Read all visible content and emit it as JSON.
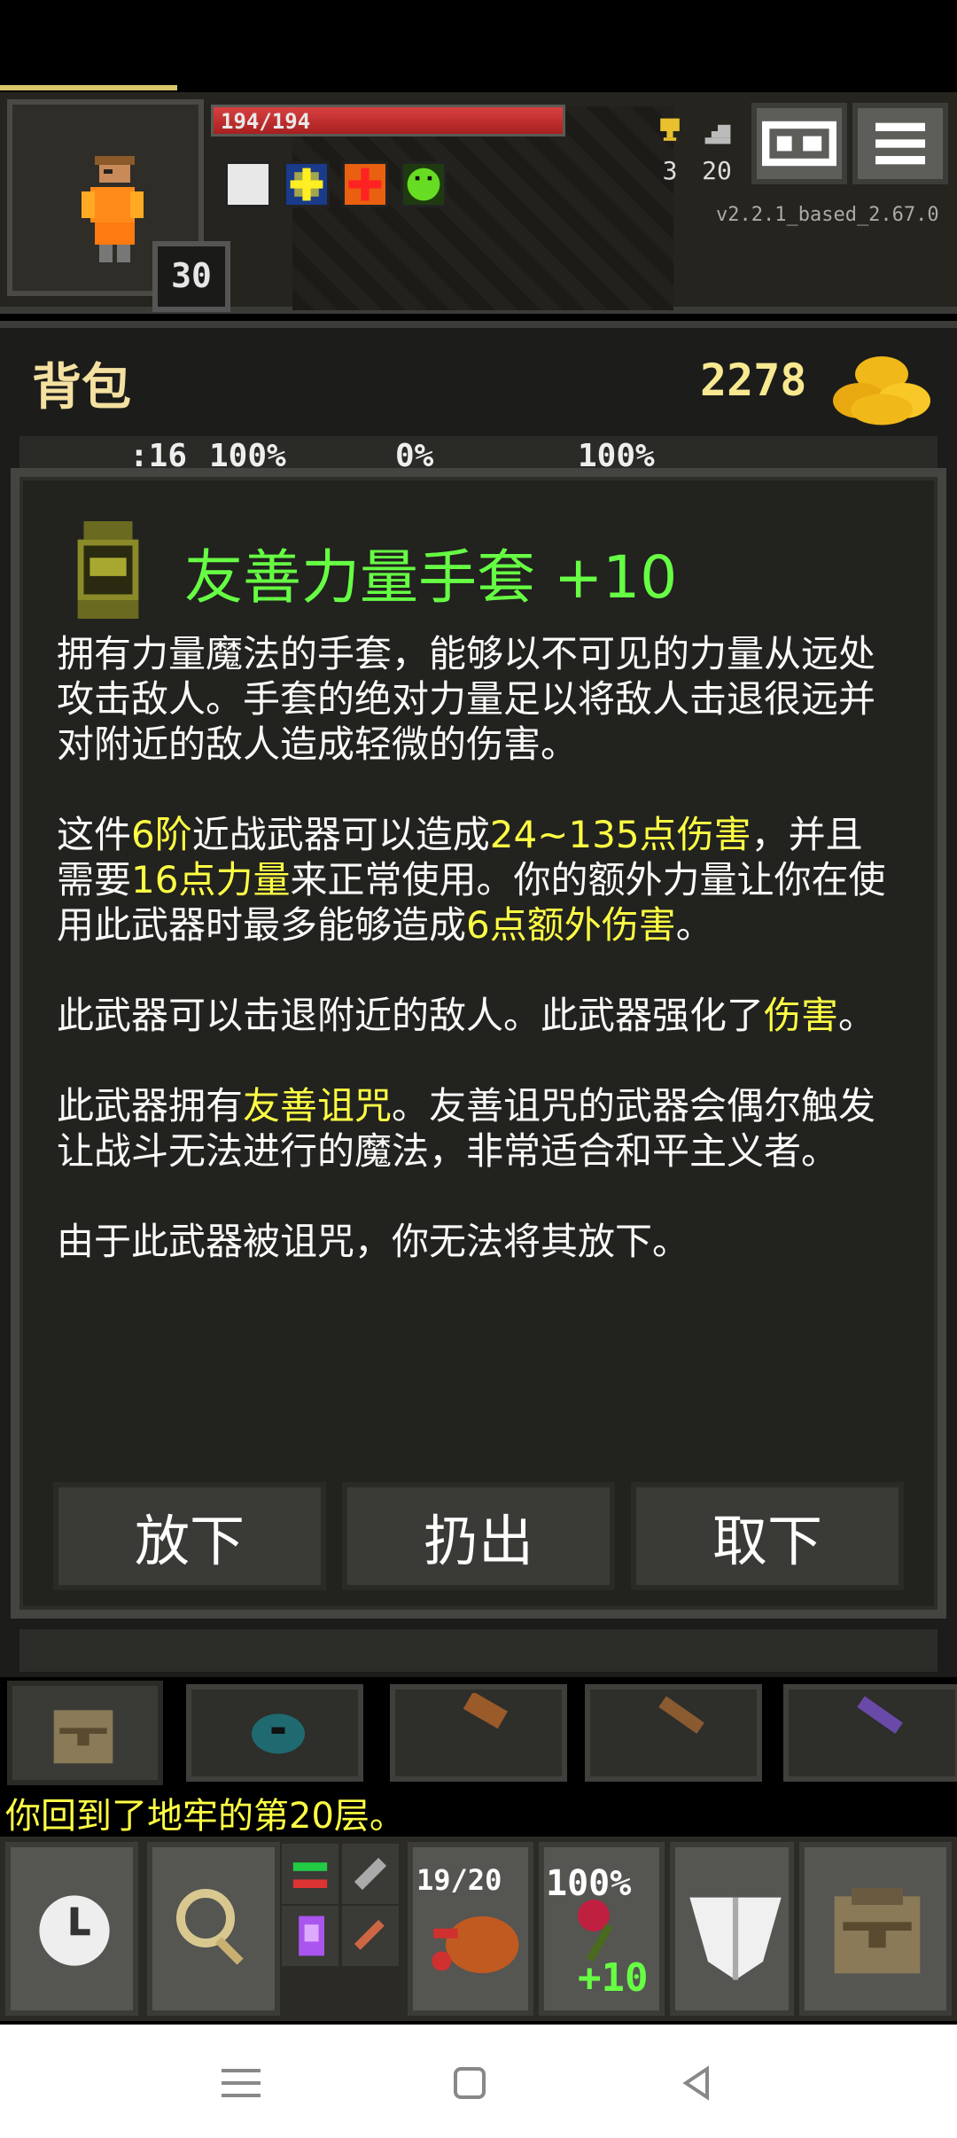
{
  "hud": {
    "hp_text": "194/194",
    "hp_fraction": 1.0,
    "level": "30",
    "gold_stat_value": "3",
    "depth_value": "20",
    "version": "v2.2.1_based_2.67.0",
    "buffs": [
      "speech-bubble-icon",
      "light-icon",
      "bless-icon",
      "toxic-icon"
    ]
  },
  "backpack": {
    "title": "背包",
    "gold": "2278",
    "stats": [
      ":16",
      "100%",
      "0%",
      "100%"
    ]
  },
  "item": {
    "title": "友善力量手套 +10",
    "desc_p1": "拥有力量魔法的手套，能够以不可见的力量从远处攻击敌人。手套的绝对力量足以将敌人击退很远并对附近的敌人造成轻微的伤害。",
    "p2_a": "这件",
    "p2_tier": "6阶",
    "p2_b": "近战武器可以造成",
    "p2_dmg": "24~135点伤害",
    "p2_c": "，并且需要",
    "p2_str": "16点力量",
    "p2_d": "来正常使用。你的额外力量让你在使用此武器时最多能够造成",
    "p2_bonus": "6点额外伤害",
    "p2_e": "。",
    "p3_a": "此武器可以击退附近的敌人。此武器强化了",
    "p3_hl": "伤害",
    "p3_b": "。",
    "p4_a": "此武器拥有",
    "p4_hl": "友善诅咒",
    "p4_b": "。友善诅咒的武器会偶尔触发让战斗无法进行的魔法，非常适合和平主义者。",
    "p5": "由于此武器被诅咒，你无法将其放下。",
    "buttons": [
      "放下",
      "扔出",
      "取下"
    ]
  },
  "log": "你回到了地牢的第20层。",
  "toolbar": {
    "food": "19/20",
    "weapon_pct": "100%",
    "upgrade": "+10"
  },
  "colors": {
    "title_green": "#66ff44",
    "highlight_yellow": "#ffff44",
    "gold_text": "#f8e890"
  }
}
